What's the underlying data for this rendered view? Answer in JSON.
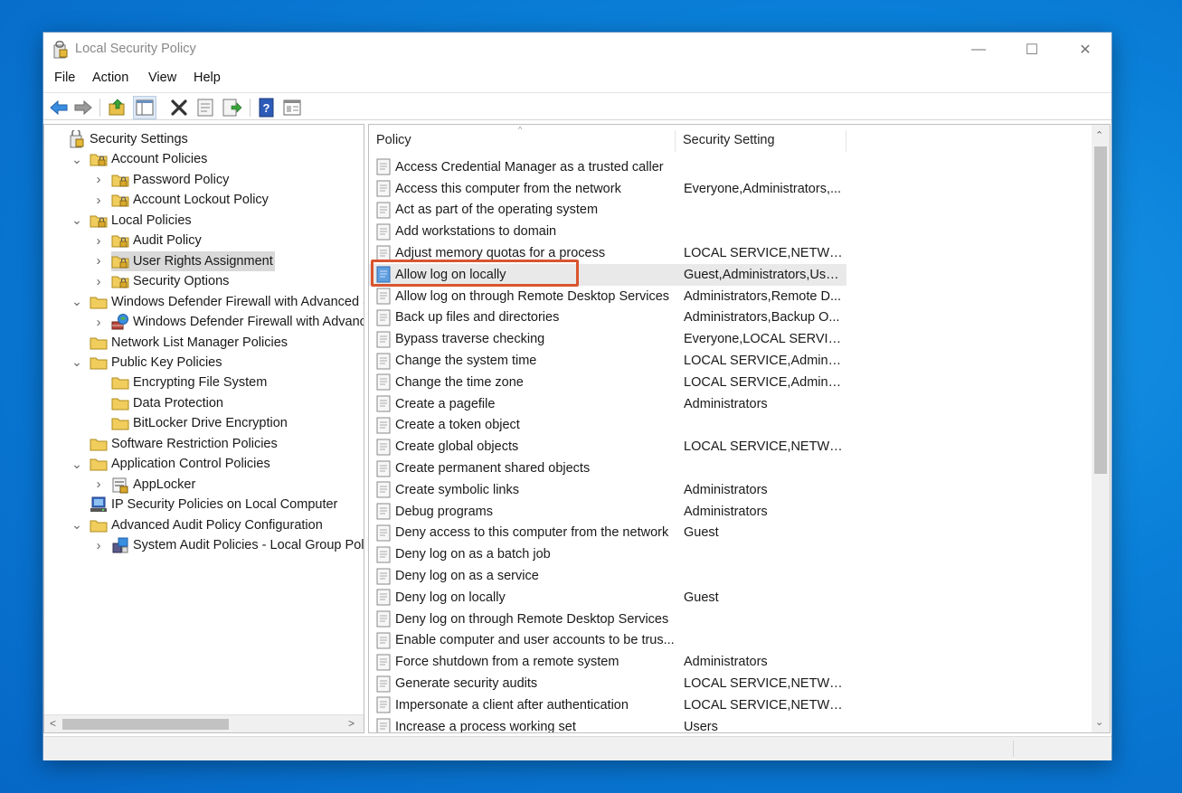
{
  "window": {
    "title": "Local Security Policy"
  },
  "title_controls": {
    "minimize": "—",
    "maximize": "☐",
    "close": "✕"
  },
  "menu": [
    "File",
    "Action",
    "View",
    "Help"
  ],
  "toolbar": [
    "back-icon",
    "forward-icon",
    "up-folder-icon",
    "show-hide-tree-icon",
    "delete-icon",
    "properties-icon",
    "export-list-icon",
    "help-icon",
    "view-icon"
  ],
  "tree": [
    {
      "label": "Security Settings",
      "level": 0,
      "expander": "",
      "icon": "security-settings-icon"
    },
    {
      "label": "Account Policies",
      "level": 1,
      "expander": "v",
      "icon": "folder-lock-icon"
    },
    {
      "label": "Password Policy",
      "level": 2,
      "expander": ">",
      "icon": "folder-lock-icon"
    },
    {
      "label": "Account Lockout Policy",
      "level": 2,
      "expander": ">",
      "icon": "folder-lock-icon"
    },
    {
      "label": "Local Policies",
      "level": 1,
      "expander": "v",
      "icon": "folder-lock-icon"
    },
    {
      "label": "Audit Policy",
      "level": 2,
      "expander": ">",
      "icon": "folder-lock-icon"
    },
    {
      "label": "User Rights Assignment",
      "level": 2,
      "expander": ">",
      "icon": "folder-lock-icon",
      "selected": true
    },
    {
      "label": "Security Options",
      "level": 2,
      "expander": ">",
      "icon": "folder-lock-icon"
    },
    {
      "label": "Windows Defender Firewall with Advanced Sec",
      "level": 1,
      "expander": "v",
      "icon": "folder-icon"
    },
    {
      "label": "Windows Defender Firewall with Advanced",
      "level": 2,
      "expander": ">",
      "icon": "firewall-icon"
    },
    {
      "label": "Network List Manager Policies",
      "level": 1,
      "expander": "",
      "icon": "folder-icon"
    },
    {
      "label": "Public Key Policies",
      "level": 1,
      "expander": "v",
      "icon": "folder-icon"
    },
    {
      "label": "Encrypting File System",
      "level": 2,
      "expander": "",
      "icon": "folder-icon"
    },
    {
      "label": "Data Protection",
      "level": 2,
      "expander": "",
      "icon": "folder-icon"
    },
    {
      "label": "BitLocker Drive Encryption",
      "level": 2,
      "expander": "",
      "icon": "folder-icon"
    },
    {
      "label": "Software Restriction Policies",
      "level": 1,
      "expander": "",
      "icon": "folder-icon"
    },
    {
      "label": "Application Control Policies",
      "level": 1,
      "expander": "v",
      "icon": "folder-icon"
    },
    {
      "label": "AppLocker",
      "level": 2,
      "expander": ">",
      "icon": "applocker-icon"
    },
    {
      "label": "IP Security Policies on Local Computer",
      "level": 1,
      "expander": "",
      "icon": "ip-security-icon"
    },
    {
      "label": "Advanced Audit Policy Configuration",
      "level": 1,
      "expander": "v",
      "icon": "folder-icon"
    },
    {
      "label": "System Audit Policies - Local Group Policy",
      "level": 2,
      "expander": ">",
      "icon": "audit-policies-icon"
    }
  ],
  "list": {
    "columns": {
      "policy": "Policy",
      "setting": "Security Setting"
    },
    "rows": [
      {
        "policy": "Access Credential Manager as a trusted caller",
        "setting": ""
      },
      {
        "policy": "Access this computer from the network",
        "setting": "Everyone,Administrators,..."
      },
      {
        "policy": "Act as part of the operating system",
        "setting": ""
      },
      {
        "policy": "Add workstations to domain",
        "setting": ""
      },
      {
        "policy": "Adjust memory quotas for a process",
        "setting": "LOCAL SERVICE,NETWOR..."
      },
      {
        "policy": "Allow log on locally",
        "setting": "Guest,Administrators,Use...",
        "selected": true
      },
      {
        "policy": "Allow log on through Remote Desktop Services",
        "setting": "Administrators,Remote D..."
      },
      {
        "policy": "Back up files and directories",
        "setting": "Administrators,Backup O..."
      },
      {
        "policy": "Bypass traverse checking",
        "setting": "Everyone,LOCAL SERVICE,..."
      },
      {
        "policy": "Change the system time",
        "setting": "LOCAL SERVICE,Administr..."
      },
      {
        "policy": "Change the time zone",
        "setting": "LOCAL SERVICE,Administr..."
      },
      {
        "policy": "Create a pagefile",
        "setting": "Administrators"
      },
      {
        "policy": "Create a token object",
        "setting": ""
      },
      {
        "policy": "Create global objects",
        "setting": "LOCAL SERVICE,NETWOR..."
      },
      {
        "policy": "Create permanent shared objects",
        "setting": ""
      },
      {
        "policy": "Create symbolic links",
        "setting": "Administrators"
      },
      {
        "policy": "Debug programs",
        "setting": "Administrators"
      },
      {
        "policy": "Deny access to this computer from the network",
        "setting": "Guest"
      },
      {
        "policy": "Deny log on as a batch job",
        "setting": ""
      },
      {
        "policy": "Deny log on as a service",
        "setting": ""
      },
      {
        "policy": "Deny log on locally",
        "setting": "Guest"
      },
      {
        "policy": "Deny log on through Remote Desktop Services",
        "setting": ""
      },
      {
        "policy": "Enable computer and user accounts to be trus...",
        "setting": ""
      },
      {
        "policy": "Force shutdown from a remote system",
        "setting": "Administrators"
      },
      {
        "policy": "Generate security audits",
        "setting": "LOCAL SERVICE,NETWOR..."
      },
      {
        "policy": "Impersonate a client after authentication",
        "setting": "LOCAL SERVICE,NETWOR..."
      },
      {
        "policy": "Increase a process working set",
        "setting": "Users"
      }
    ]
  },
  "colors": {
    "accent_highlight": "#d9552f",
    "selected_row": "#e9e9e9",
    "tree_selected": "#d9d9d9"
  }
}
